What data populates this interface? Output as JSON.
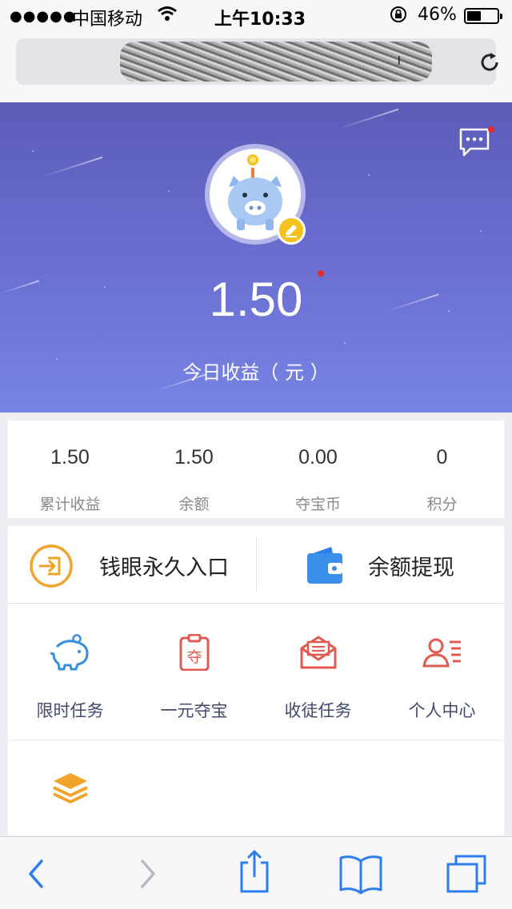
{
  "status_bar": {
    "signal": "●●●●●",
    "carrier": "中国移动",
    "time": "上午10:33",
    "battery_percent": "46%",
    "battery_level": 0.46
  },
  "address_bar": {
    "url_visible_fragment": "ı"
  },
  "hero": {
    "today_earnings": "1.50",
    "today_earnings_label": "今日收益（ 元 ）"
  },
  "stats": [
    {
      "value": "1.50",
      "label": "累计收益"
    },
    {
      "value": "1.50",
      "label": "余额"
    },
    {
      "value": "0.00",
      "label": "夺宝币"
    },
    {
      "value": "0",
      "label": "积分"
    }
  ],
  "actions": {
    "entry_label": "钱眼永久入口",
    "withdraw_label": "余额提现"
  },
  "grid": [
    {
      "label": "限时任务",
      "icon": "piggy-bank-icon"
    },
    {
      "label": "一元夺宝",
      "icon": "treasure-clipboard-icon"
    },
    {
      "label": "收徒任务",
      "icon": "envelope-icon"
    },
    {
      "label": "个人中心",
      "icon": "profile-card-icon"
    },
    {
      "label": "",
      "icon": "layers-icon"
    }
  ],
  "colors": {
    "hero_top": "#5c5cb8",
    "hero_bottom": "#7784e4",
    "accent_orange": "#f0a52a",
    "accent_blue": "#3a8fdc",
    "accent_red": "#e05a4f",
    "safari_blue": "#2c7ef0",
    "notification_red": "#e52a2a"
  }
}
